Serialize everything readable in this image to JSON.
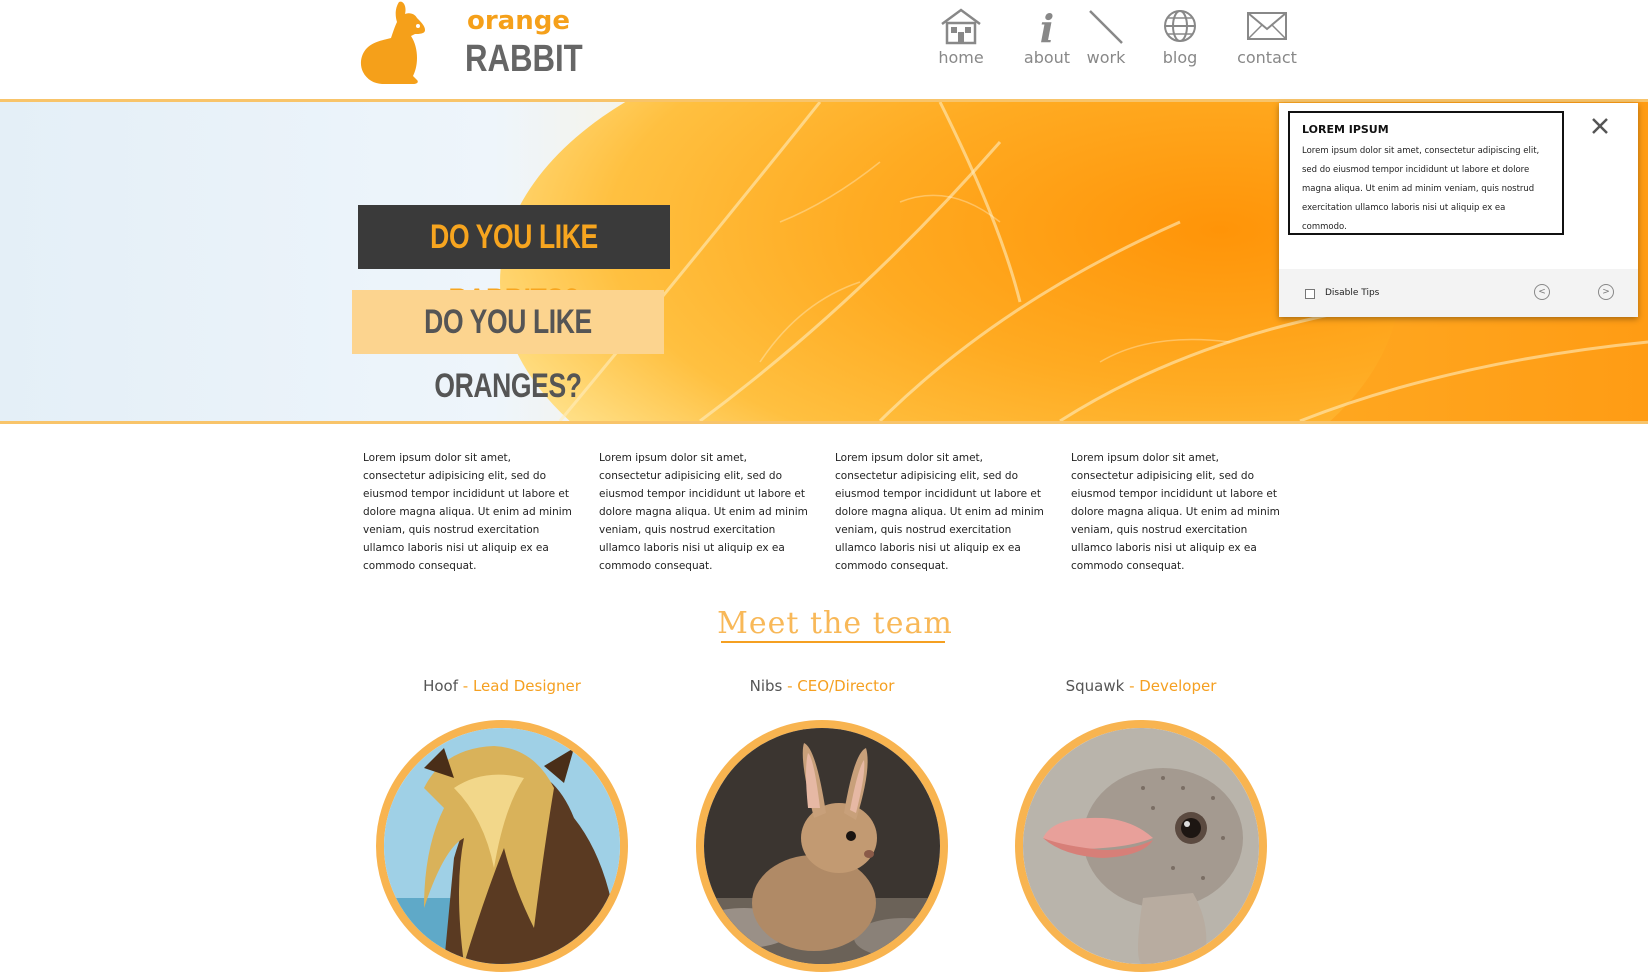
{
  "brand": {
    "top": "orange",
    "bottom": "RABBIT"
  },
  "nav": [
    {
      "label": "home",
      "icon": "home-icon"
    },
    {
      "label": "about",
      "icon": "info-icon"
    },
    {
      "label": "work",
      "icon": "pencil-icon"
    },
    {
      "label": "blog",
      "icon": "globe-icon"
    },
    {
      "label": "contact",
      "icon": "envelope-icon"
    }
  ],
  "hero": {
    "question_1": "DO YOU LIKE RABBITS?",
    "question_2": "DO YOU LIKE ORANGES?"
  },
  "tip": {
    "title": "LOREM IPSUM",
    "body": "Lorem ipsum dolor sit amet, consectetur adipiscing elit, sed do eiusmod tempor incididunt ut labore et dolore magna aliqua. Ut enim ad minim veniam, quis nostrud exercitation ullamco laboris nisi ut aliquip ex ea commodo.",
    "checkbox_label": "Disable Tips",
    "checked": false,
    "prev_symbol": "<",
    "next_symbol": ">"
  },
  "columns": [
    "Lorem ipsum dolor sit amet, consectetur adipisicing elit, sed do eiusmod tempor incididunt ut labore et dolore magna aliqua. Ut enim ad minim veniam, quis nostrud exercitation ullamco laboris nisi ut aliquip ex ea commodo consequat.",
    "Lorem ipsum dolor sit amet, consectetur adipisicing elit, sed do eiusmod tempor incididunt ut labore et dolore magna aliqua. Ut enim ad minim veniam, quis nostrud exercitation ullamco laboris nisi ut aliquip ex ea commodo consequat.",
    "Lorem ipsum dolor sit amet, consectetur adipisicing elit, sed do eiusmod tempor incididunt ut labore et dolore magna aliqua. Ut enim ad minim veniam, quis nostrud exercitation ullamco laboris nisi ut aliquip ex ea commodo consequat.",
    "Lorem ipsum dolor sit amet, consectetur adipisicing elit, sed do eiusmod tempor incididunt ut labore et dolore magna aliqua. Ut enim ad minim veniam, quis nostrud exercitation ullamco laboris nisi ut aliquip ex ea commodo consequat."
  ],
  "team": {
    "title": "Meet the team",
    "members": [
      {
        "name": "Hoof",
        "separator": " - ",
        "role": "Lead Designer",
        "photo": "horse"
      },
      {
        "name": "Nibs",
        "separator": " - ",
        "role": "CEO/Director",
        "photo": "rabbit"
      },
      {
        "name": "Squawk",
        "separator": " - ",
        "role": "Developer",
        "photo": "ostrich"
      }
    ]
  },
  "colors": {
    "accent": "#f5a021",
    "accent_light": "#f8c46a",
    "dark": "#3a3a3a",
    "text_grey": "#888888"
  }
}
